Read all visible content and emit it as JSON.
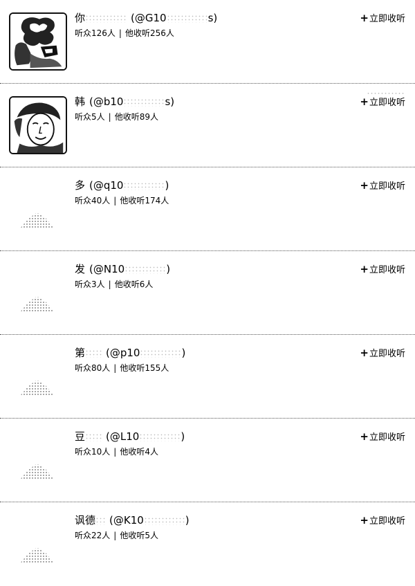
{
  "users": [
    {
      "name": "你",
      "handle": "(@G10",
      "handle_tail": "s)",
      "listeners_label": "听众126人",
      "following_label": "他收听256人",
      "follow_label": "立即收听",
      "avatar_icon": "avatar-cartoon-icon",
      "has_avatar": true
    },
    {
      "name": "韩",
      "handle": "(@b10",
      "handle_tail": "s)",
      "listeners_label": "听众5人",
      "following_label": "他收听89人",
      "follow_label": "立即收听",
      "avatar_icon": "avatar-face-icon",
      "has_avatar": true
    },
    {
      "name": "多",
      "handle": "(@q10",
      "handle_tail": ")",
      "listeners_label": "听众40人",
      "following_label": "他收听174人",
      "follow_label": "立即收听",
      "avatar_icon": "avatar-placeholder-icon",
      "has_avatar": false
    },
    {
      "name": "发",
      "handle": "(@N10",
      "handle_tail": ")",
      "listeners_label": "听众3人",
      "following_label": "他收听6人",
      "follow_label": "立即收听",
      "avatar_icon": "avatar-placeholder-icon",
      "has_avatar": false
    },
    {
      "name": "第",
      "handle": "(@p10",
      "handle_tail": ")",
      "listeners_label": "听众80人",
      "following_label": "他收听155人",
      "follow_label": "立即收听",
      "avatar_icon": "avatar-placeholder-icon",
      "has_avatar": false
    },
    {
      "name": "豆",
      "handle": "(@L10",
      "handle_tail": ")",
      "listeners_label": "听众10人",
      "following_label": "他收听4人",
      "follow_label": "立即收听",
      "avatar_icon": "avatar-placeholder-icon",
      "has_avatar": false
    },
    {
      "name": "讽德",
      "handle": "(@K10",
      "handle_tail": ")",
      "listeners_label": "听众22人",
      "following_label": "他收听5人",
      "follow_label": "立即收听",
      "avatar_icon": "avatar-placeholder-icon",
      "has_avatar": false
    }
  ],
  "stats_separator": "|",
  "plus_glyph": "+"
}
